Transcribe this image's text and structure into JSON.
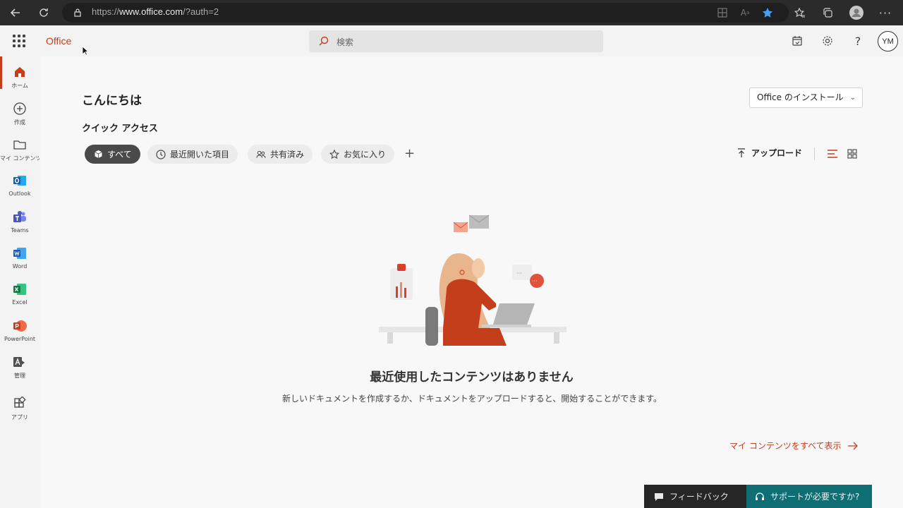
{
  "browser": {
    "url_prefix": "https://",
    "url_domain": "www.office.com",
    "url_path": "/?auth=2"
  },
  "header": {
    "brand": "Office",
    "search_placeholder": "検索",
    "avatar_initials": "YM"
  },
  "rail": {
    "items": [
      {
        "label": "ホーム",
        "icon": "home-icon",
        "active": true
      },
      {
        "label": "作成",
        "icon": "create-icon"
      },
      {
        "label": "マイ コンテンツ",
        "icon": "folder-icon"
      },
      {
        "label": "Outlook",
        "icon": "outlook-icon"
      },
      {
        "label": "Teams",
        "icon": "teams-icon"
      },
      {
        "label": "Word",
        "icon": "word-icon"
      },
      {
        "label": "Excel",
        "icon": "excel-icon"
      },
      {
        "label": "PowerPoint",
        "icon": "powerpoint-icon"
      },
      {
        "label": "管理",
        "icon": "admin-icon"
      },
      {
        "label": "アプリ",
        "icon": "apps-icon"
      }
    ]
  },
  "main": {
    "greeting": "こんにちは",
    "install_label": "Office のインストール",
    "quick_access": "クイック アクセス",
    "filters": [
      "すべて",
      "最近開いた項目",
      "共有済み",
      "お気に入り"
    ],
    "upload_label": "アップロード",
    "empty_title": "最近使用したコンテンツはありません",
    "empty_desc": "新しいドキュメントを作成するか、ドキュメントをアップロードすると、開始することができます。",
    "my_content_link": "マイ コンテンツをすべて表示"
  },
  "footer": {
    "feedback": "フィードバック",
    "support": "サポートが必要ですか?"
  },
  "colors": {
    "accent": "#c43e1c",
    "support_bg": "#0f6e74"
  }
}
